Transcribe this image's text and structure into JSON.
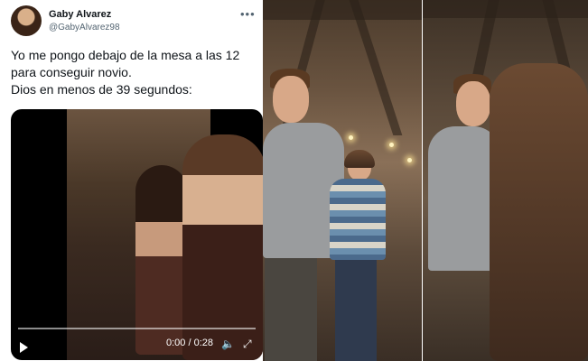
{
  "tweet": {
    "display_name": "Gaby Alvarez",
    "handle": "@GabyAlvarez98",
    "text_lines": [
      "Yo me pongo debajo de la mesa a las 12",
      "para conseguir novio.",
      "Dios en menos de 39 segundos:"
    ],
    "video": {
      "time": "0:00 / 0:28",
      "progress": 0
    }
  },
  "icons": [
    "more-icon",
    "play-icon",
    "volume-icon",
    "fullscreen-icon"
  ]
}
